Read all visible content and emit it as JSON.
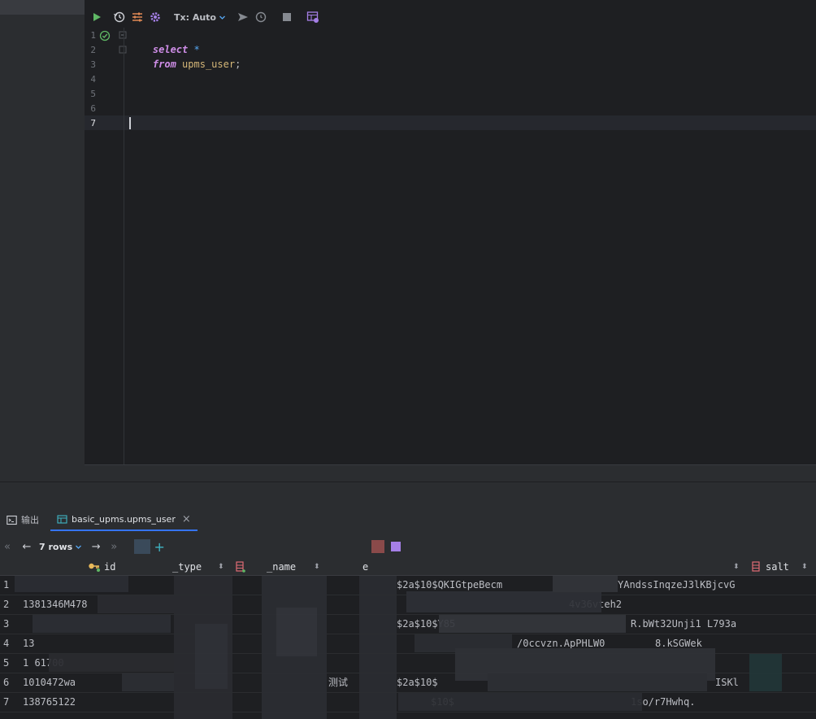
{
  "toolbar": {
    "tx_label": "Tx: Auto",
    "icons": [
      "run-icon",
      "history-icon",
      "settings-sliders-icon",
      "gear-icon",
      "commit-icon",
      "rollback-icon",
      "stop-icon",
      "table-settings-icon"
    ]
  },
  "editor": {
    "line_numbers": [
      "1",
      "2",
      "3",
      "4",
      "5",
      "6",
      "7"
    ],
    "line1_kw": "select",
    "line1_star": "*",
    "line2_kw": "from",
    "line2_table": "upms_user",
    "line2_semicolon": ";"
  },
  "bottom_tabs": [
    {
      "label": "输出",
      "icon": "console-icon"
    },
    {
      "label": "basic_upms.upms_user",
      "icon": "table-icon",
      "close": "×"
    }
  ],
  "result_toolbar": {
    "rows_label": "7 rows",
    "first": "«",
    "prev": "←",
    "next": "→",
    "last": "»",
    "add": "+"
  },
  "grid": {
    "columns": [
      {
        "label": "id"
      },
      {
        "label": "_type"
      },
      {
        "label": "_name"
      },
      {
        "label": "e"
      },
      {
        "label": "salt"
      }
    ],
    "rows": [
      {
        "n": "1",
        "c1": "",
        "c4": "$2a$10$QKIGtpeBecm",
        "c5": "YAndssInqzeJ3lKBjcvG"
      },
      {
        "n": "2",
        "c1": "1381346M478",
        "c4": "",
        "c5": "4v36vteh2"
      },
      {
        "n": "3",
        "c1": "",
        "c4": "$2a$10$Y85",
        "c5": "R.bWt32Unji1 L793a"
      },
      {
        "n": "4",
        "c1": "13",
        "c4": "/0ccvzn.ApPHLW0",
        "c5": "8.kSGWek"
      },
      {
        "n": "5",
        "c1": "1  61700",
        "c4": "",
        "c5": ""
      },
      {
        "n": "6",
        "c1": "1010472wa",
        "c3": "测试",
        "c4": "$2a$10$",
        "c5": "ISKl"
      },
      {
        "n": "7",
        "c1": "138765122",
        "c4": "$10$",
        "c5": "1so/r7Hwhq."
      }
    ]
  },
  "colors": {
    "bg": "#1e1f22",
    "panel": "#2b2d30",
    "accent": "#3574f0",
    "keyword": "#cf8ee8",
    "identifier": "#d5b778",
    "run": "#5fb865"
  }
}
